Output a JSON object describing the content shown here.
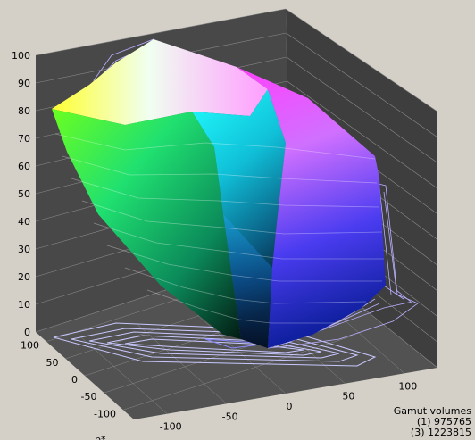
{
  "chart_data": {
    "type": "3d-surface",
    "title": "",
    "axes": {
      "z": {
        "label": "",
        "ticks": [
          "0",
          "10",
          "20",
          "30",
          "40",
          "50",
          "60",
          "70",
          "80",
          "90",
          "100"
        ],
        "range": [
          0,
          100
        ]
      },
      "b": {
        "label": "b*",
        "ticks": [
          "100",
          "50",
          "0",
          "-50",
          "-100"
        ],
        "range": [
          -128,
          128
        ]
      },
      "a": {
        "label": "",
        "ticks": [
          "-100",
          "-50",
          "0",
          "50",
          "100"
        ],
        "range": [
          -128,
          128
        ]
      }
    },
    "grid": true,
    "background": "#484848",
    "series": [
      {
        "name": "(1)",
        "style": "solid colored surface",
        "volume": 975765
      },
      {
        "name": "(3)",
        "style": "wireframe",
        "volume": 1223815
      }
    ]
  },
  "legend": {
    "title": "Gamut volumes",
    "entries": [
      {
        "id": "(1)",
        "value": "975765"
      },
      {
        "id": "(3)",
        "value": "1223815"
      }
    ]
  },
  "colors": {
    "pane": "#484848",
    "grid": "#8a8a8a",
    "window": "#d4d0c8",
    "wire": "#b9b0ff"
  }
}
